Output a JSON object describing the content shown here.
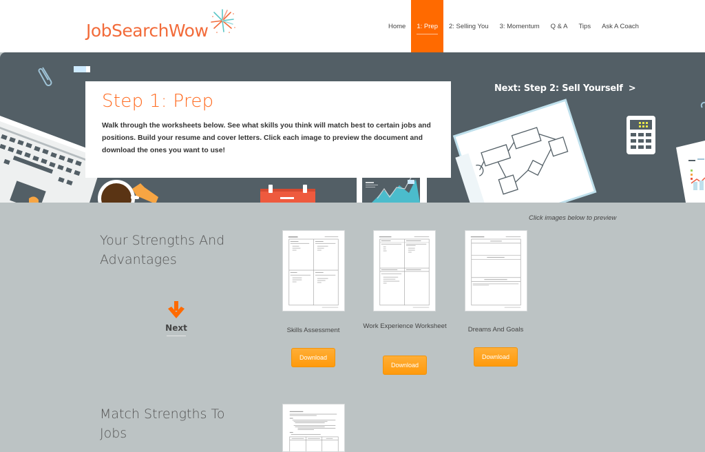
{
  "brand": {
    "name": "JobSearchWow",
    "accent_color": "#ff6a00",
    "logo_color": "#f26b3a"
  },
  "nav": {
    "items": [
      {
        "label": "Home",
        "active": false
      },
      {
        "label": "1: Prep",
        "active": true
      },
      {
        "label": "2: Selling You",
        "active": false
      },
      {
        "label": "3: Momentum",
        "active": false
      },
      {
        "label": "Q & A",
        "active": false
      },
      {
        "label": "Tips",
        "active": false
      },
      {
        "label": "Ask A Coach",
        "active": false
      }
    ]
  },
  "hero": {
    "title": "Step 1:  Prep",
    "description": "Walk through the worksheets below.  See what skills you think will match best to certain jobs and positions.  Build your resume and cover letters.  Click each image to preview the document and download the ones you want to use!",
    "next_link": "Next: Step 2:  Sell Yourself",
    "next_icon": "chevron-right-icon",
    "background_color": "#535f66"
  },
  "main": {
    "preview_hint": "Click images below to preview",
    "sections": [
      {
        "title": "Your Strengths And Advantages",
        "next_label": "Next",
        "next_icon": "arrow-down-icon",
        "worksheets": [
          {
            "label": "Skills Assessment",
            "button": "Download"
          },
          {
            "label": "Work Experience Worksheet",
            "button": "Download"
          },
          {
            "label": "Dreams And Goals",
            "button": "Download"
          }
        ]
      },
      {
        "title": "Match Strengths To Jobs",
        "worksheets": []
      }
    ]
  }
}
